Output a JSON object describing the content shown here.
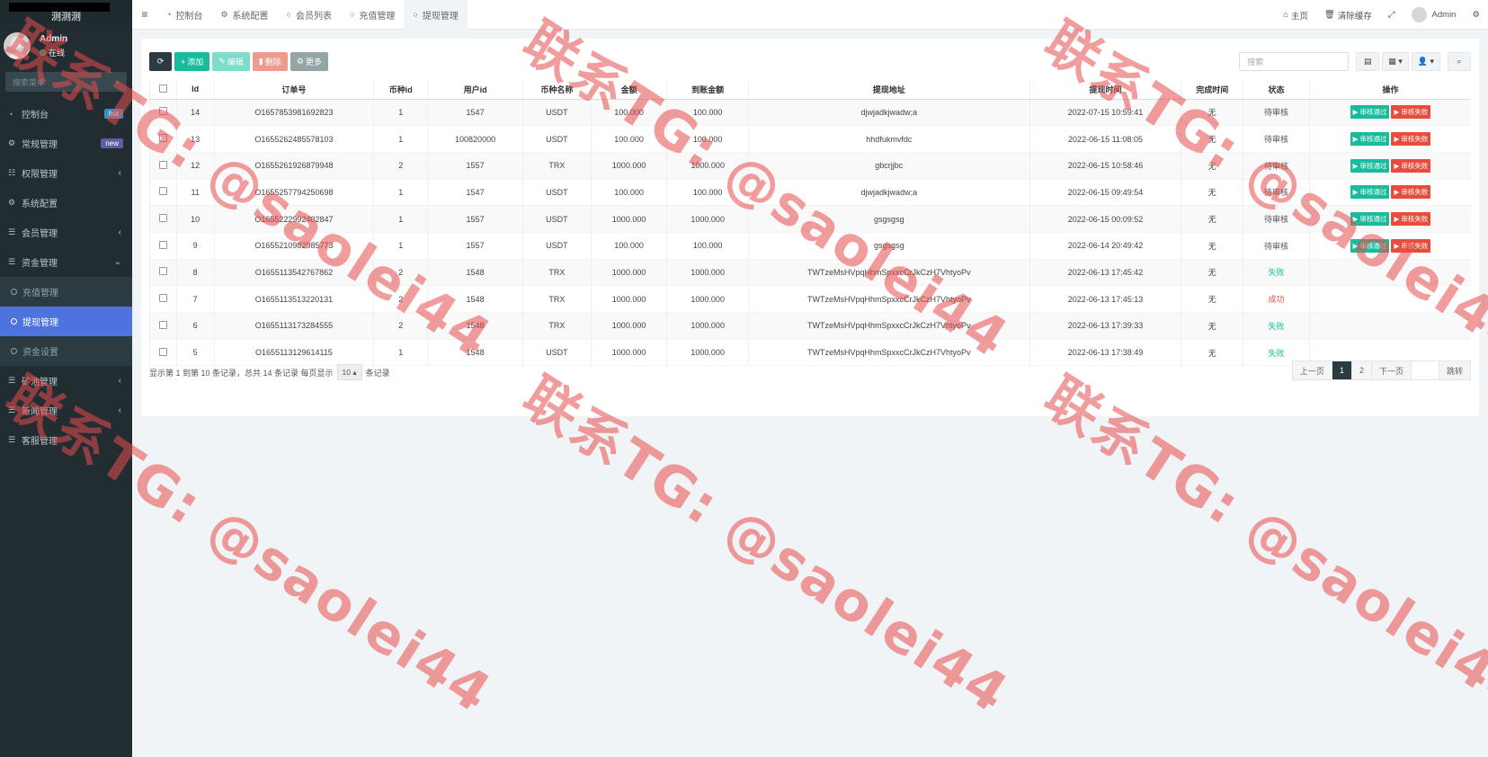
{
  "sidebar": {
    "brand": "测测测",
    "user": {
      "name": "Admin",
      "status": "在线"
    },
    "search_placeholder": "搜索菜单",
    "items": [
      {
        "label": "控制台",
        "icon": "dashboard-icon",
        "badge": "hot"
      },
      {
        "label": "常规管理",
        "icon": "cogs-icon",
        "badge": "new"
      },
      {
        "label": "权限管理",
        "icon": "group-icon",
        "chevron": "‹"
      },
      {
        "label": "系统配置",
        "icon": "gear-icon"
      },
      {
        "label": "会员管理",
        "icon": "list-icon",
        "chevron": "‹"
      },
      {
        "label": "资金管理",
        "icon": "list-icon",
        "chevron": "⌄"
      }
    ],
    "sub_items": [
      {
        "label": "充值管理"
      },
      {
        "label": "提现管理"
      },
      {
        "label": "资金设置"
      }
    ],
    "items_after": [
      {
        "label": "矿池管理",
        "icon": "list-icon",
        "chevron": "‹"
      },
      {
        "label": "新闻管理",
        "icon": "list-icon",
        "chevron": "‹"
      },
      {
        "label": "客服管理",
        "icon": "list-icon"
      }
    ]
  },
  "topbar": {
    "tabs": [
      {
        "label": "控制台",
        "icon": "dashboard-icon"
      },
      {
        "label": "系统配置",
        "icon": "gear-icon"
      },
      {
        "label": "会员列表",
        "icon": "circle-icon"
      },
      {
        "label": "充值管理",
        "icon": "circle-icon"
      },
      {
        "label": "提现管理",
        "icon": "circle-icon"
      }
    ],
    "home": "主页",
    "clear_cache": "清除缓存",
    "admin": "Admin"
  },
  "toolbar": {
    "add": "添加",
    "edit": "编辑",
    "delete": "删除",
    "more": "更多",
    "search_placeholder": "搜索"
  },
  "table": {
    "headers": [
      "Id",
      "订单号",
      "币种id",
      "用户id",
      "币种名称",
      "金额",
      "到账金额",
      "提现地址",
      "提现时间",
      "完成时间",
      "状态",
      "操作"
    ],
    "rows": [
      {
        "id": "14",
        "order": "O1657853981692823",
        "coin_id": "1",
        "user_id": "1547",
        "coin": "USDT",
        "amount": "100.000",
        "received": "100.000",
        "address": "djwjadkjwadw;a",
        "time": "2022-07-15 10:59:41",
        "done": "无",
        "status": "待审核",
        "status_type": "pending"
      },
      {
        "id": "13",
        "order": "O1655262485578103",
        "coin_id": "1",
        "user_id": "100820000",
        "coin": "USDT",
        "amount": "100.000",
        "received": "100.000",
        "address": "hhdfukmvfdc",
        "time": "2022-06-15 11:08:05",
        "done": "无",
        "status": "待审核",
        "status_type": "pending"
      },
      {
        "id": "12",
        "order": "O1655261926879948",
        "coin_id": "2",
        "user_id": "1557",
        "coin": "TRX",
        "amount": "1000.000",
        "received": "1000.000",
        "address": "gbcrjjbc",
        "time": "2022-06-15 10:58:46",
        "done": "无",
        "status": "待审核",
        "status_type": "pending"
      },
      {
        "id": "11",
        "order": "O1655257794250698",
        "coin_id": "1",
        "user_id": "1547",
        "coin": "USDT",
        "amount": "100.000",
        "received": "100.000",
        "address": "djwjadkjwadw;a",
        "time": "2022-06-15 09:49:54",
        "done": "无",
        "status": "待审核",
        "status_type": "pending"
      },
      {
        "id": "10",
        "order": "O1655222992402847",
        "coin_id": "1",
        "user_id": "1557",
        "coin": "USDT",
        "amount": "1000.000",
        "received": "1000.000",
        "address": "gsgsgsg",
        "time": "2022-06-15 00:09:52",
        "done": "无",
        "status": "待审核",
        "status_type": "pending"
      },
      {
        "id": "9",
        "order": "O1655210982985773",
        "coin_id": "1",
        "user_id": "1557",
        "coin": "USDT",
        "amount": "100.000",
        "received": "100.000",
        "address": "gsgsgsg",
        "time": "2022-06-14 20:49:42",
        "done": "无",
        "status": "待审核",
        "status_type": "pending"
      },
      {
        "id": "8",
        "order": "O1655113542767862",
        "coin_id": "2",
        "user_id": "1548",
        "coin": "TRX",
        "amount": "1000.000",
        "received": "1000.000",
        "address": "TWTzeMsHVpqHhmSpxxcCrJkCzH7VhtyoPv",
        "time": "2022-06-13 17:45:42",
        "done": "无",
        "status": "失败",
        "status_type": "fail"
      },
      {
        "id": "7",
        "order": "O1655113513220131",
        "coin_id": "2",
        "user_id": "1548",
        "coin": "TRX",
        "amount": "1000.000",
        "received": "1000.000",
        "address": "TWTzeMsHVpqHhmSpxxcCrJkCzH7VhtyoPv",
        "time": "2022-06-13 17:45:13",
        "done": "无",
        "status": "成功",
        "status_type": "ok"
      },
      {
        "id": "6",
        "order": "O1655113173284555",
        "coin_id": "2",
        "user_id": "1548",
        "coin": "TRX",
        "amount": "1000.000",
        "received": "1000.000",
        "address": "TWTzeMsHVpqHhmSpxxcCrJkCzH7VhtyoPv",
        "time": "2022-06-13 17:39:33",
        "done": "无",
        "status": "失败",
        "status_type": "fail"
      },
      {
        "id": "5",
        "order": "O1655113129614115",
        "coin_id": "1",
        "user_id": "1548",
        "coin": "USDT",
        "amount": "1000.000",
        "received": "1000.000",
        "address": "TWTzeMsHVpqHhmSpxxcCrJkCzH7VhtyoPv",
        "time": "2022-06-13 17:38:49",
        "done": "无",
        "status": "失败",
        "status_type": "fail"
      }
    ],
    "approve_label": "▶ 审核通过",
    "reject_label": "▶ 审核失败"
  },
  "footer": {
    "summary": "显示第 1 到第 10 条记录，总共 14 条记录 每页显示",
    "page_size": "10",
    "suffix": "条记录",
    "prev": "上一页",
    "pages": [
      "1",
      "2"
    ],
    "next": "下一页",
    "jump": "跳转"
  },
  "watermark": "联系TG: @saolei44",
  "colors": {
    "sidebar_bg": "#222d32",
    "active_item": "#4e73df",
    "success": "#18bc9c",
    "danger": "#e74c3c"
  }
}
